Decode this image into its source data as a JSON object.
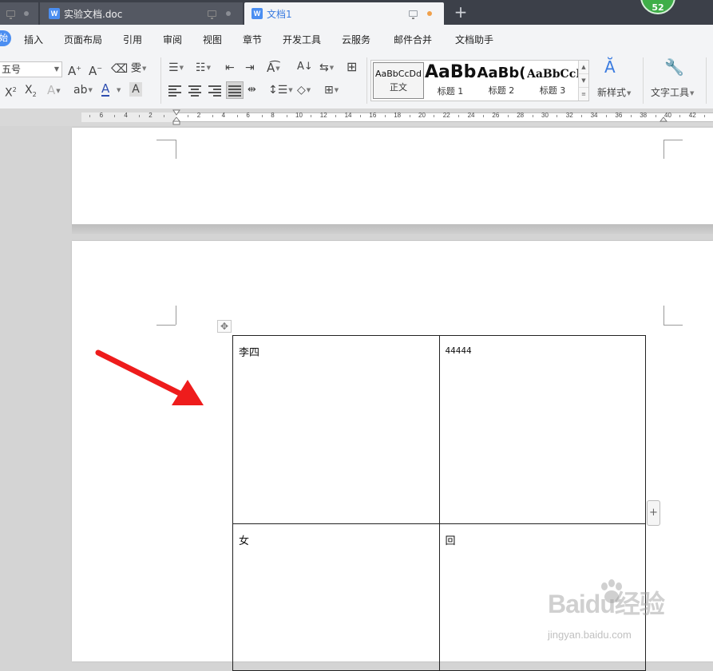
{
  "tabs": [
    {
      "label": "实验文档.doc",
      "icon": "word-doc-icon"
    },
    {
      "label": "文档1",
      "icon": "word-doc-icon",
      "active": true
    }
  ],
  "badge": {
    "count": "52"
  },
  "menu": {
    "start_label": "始",
    "items": [
      "插入",
      "页面布局",
      "引用",
      "审阅",
      "视图",
      "章节",
      "开发工具",
      "云服务",
      "邮件合并",
      "文档助手"
    ]
  },
  "toolbar": {
    "font_size": "五号",
    "styles": [
      {
        "sample": "AaBbCcDd",
        "name": "正文"
      },
      {
        "sample": "AaBb",
        "name": "标题 1"
      },
      {
        "sample": "AaBb(",
        "name": "标题 2"
      },
      {
        "sample": "AaBbCcI",
        "name": "标题 3"
      }
    ],
    "new_style_label": "新样式",
    "text_tools_label": "文字工具"
  },
  "ruler": {
    "left_numbers": [
      "6",
      "4",
      "2"
    ],
    "numbers": [
      "2",
      "4",
      "6",
      "8",
      "10",
      "12",
      "14",
      "16",
      "18",
      "20",
      "22",
      "24",
      "26",
      "28",
      "30",
      "32",
      "34",
      "36",
      "38",
      "40",
      "42"
    ]
  },
  "table": {
    "rows": [
      [
        "李四",
        "44444"
      ],
      [
        "女",
        "回"
      ]
    ]
  },
  "watermark": {
    "brand": "Baidu经验",
    "url": "jingyan.baidu.com"
  },
  "colors": {
    "tabbar": "#3c4049",
    "accent": "#4b8ef1",
    "annotation_arrow": "#ee1c1c",
    "badge": "#3fae48"
  }
}
